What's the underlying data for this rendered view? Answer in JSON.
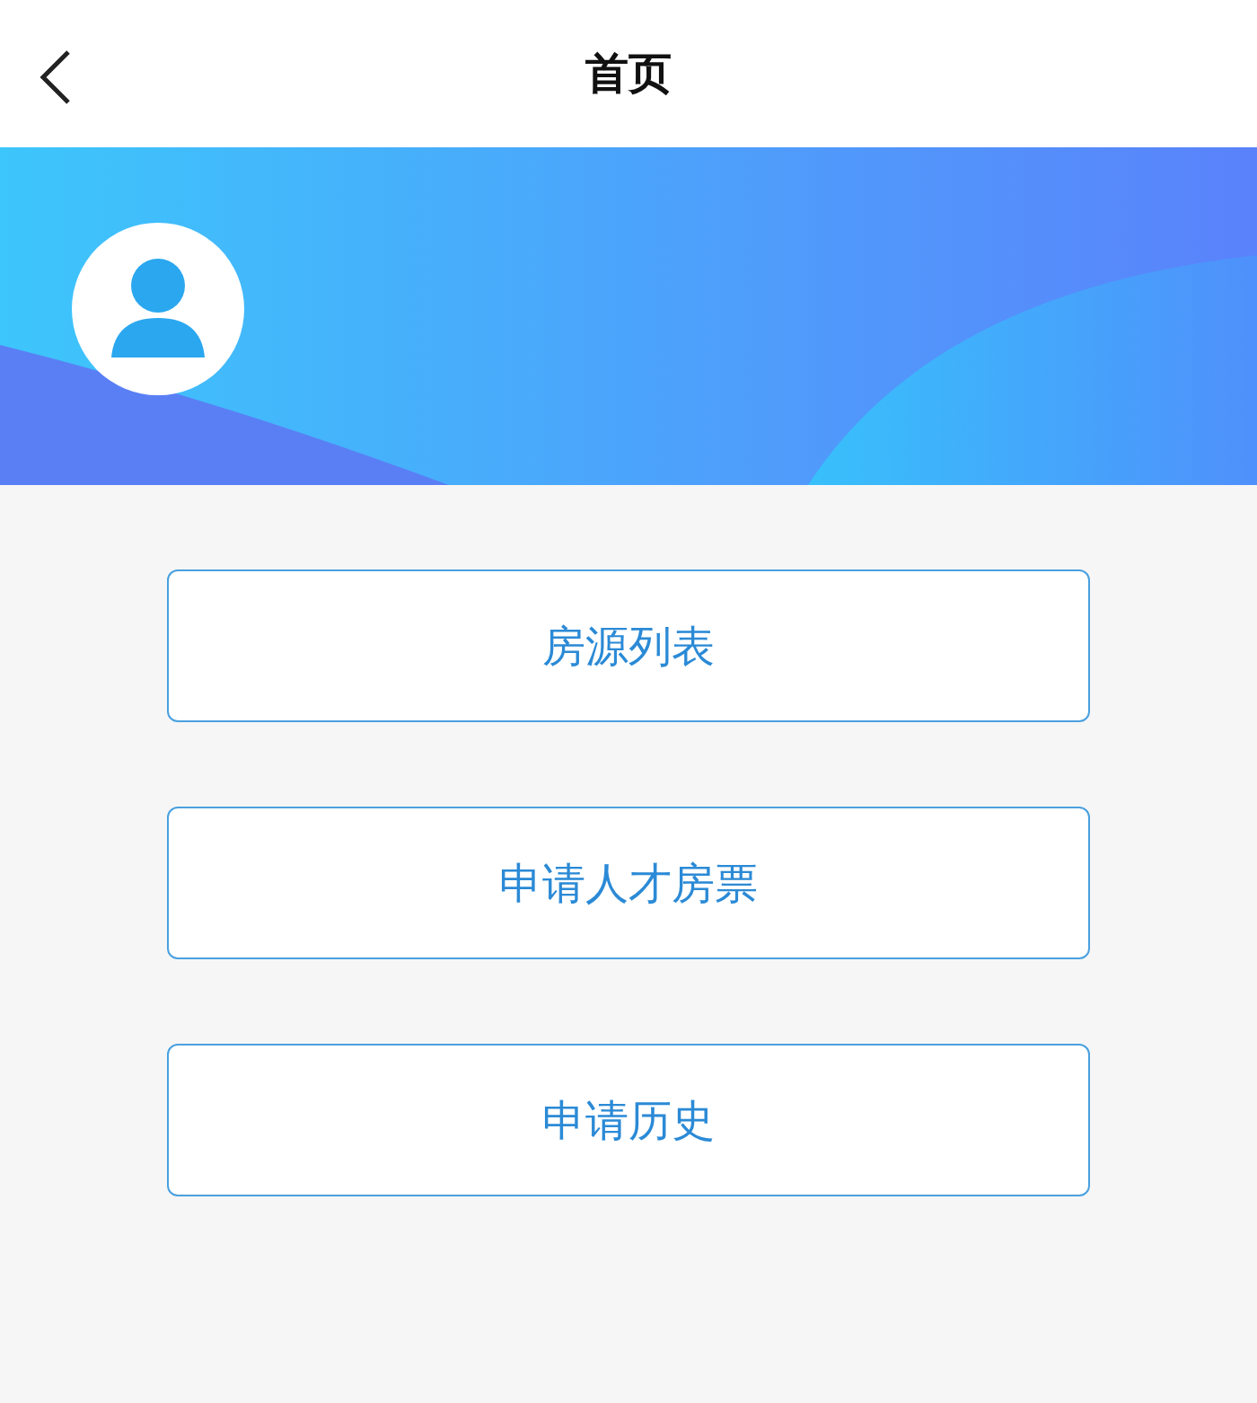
{
  "header": {
    "title": "首页"
  },
  "menu": [
    {
      "label": "房源列表"
    },
    {
      "label": "申请人才房票"
    },
    {
      "label": "申请历史"
    }
  ]
}
